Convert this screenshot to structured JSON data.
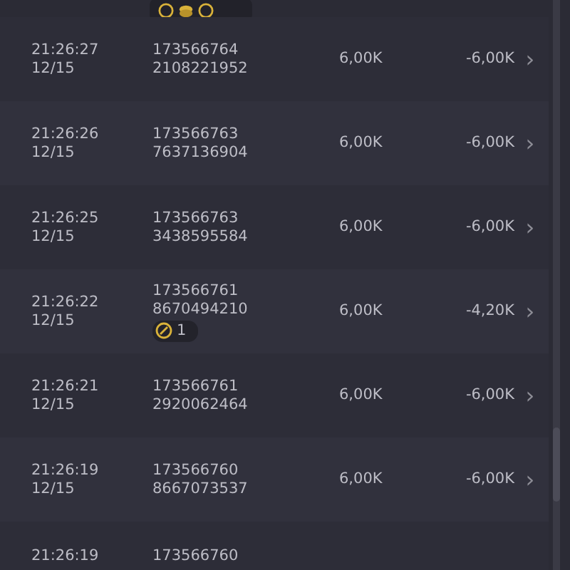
{
  "transactions": [
    {
      "time": "21:26:27",
      "date": "12/15",
      "id_line_1": "173566764",
      "id_line_2": "2108221952",
      "amount": "6,00K",
      "change": "-6,00K",
      "chevron": "›"
    },
    {
      "time": "21:26:26",
      "date": "12/15",
      "id_line_1": "173566763",
      "id_line_2": "7637136904",
      "amount": "6,00K",
      "change": "-6,00K",
      "chevron": "›"
    },
    {
      "time": "21:26:25",
      "date": "12/15",
      "id_line_1": "173566763",
      "id_line_2": "3438595584",
      "amount": "6,00K",
      "change": "-6,00K",
      "chevron": "›"
    },
    {
      "time": "21:26:22",
      "date": "12/15",
      "id_line_1": "173566761",
      "id_line_2": "8670494210",
      "badge": {
        "count": "1"
      },
      "amount": "6,00K",
      "change": "-4,20K",
      "chevron": "›"
    },
    {
      "time": "21:26:21",
      "date": "12/15",
      "id_line_1": "173566761",
      "id_line_2": "2920062464",
      "amount": "6,00K",
      "change": "-6,00K",
      "chevron": "›"
    },
    {
      "time": "21:26:19",
      "date": "12/15",
      "id_line_1": "173566760",
      "id_line_2": "8667073537",
      "amount": "6,00K",
      "change": "-6,00K",
      "chevron": "›"
    },
    {
      "time": "21:26:19",
      "id_line_1": "173566760"
    }
  ]
}
